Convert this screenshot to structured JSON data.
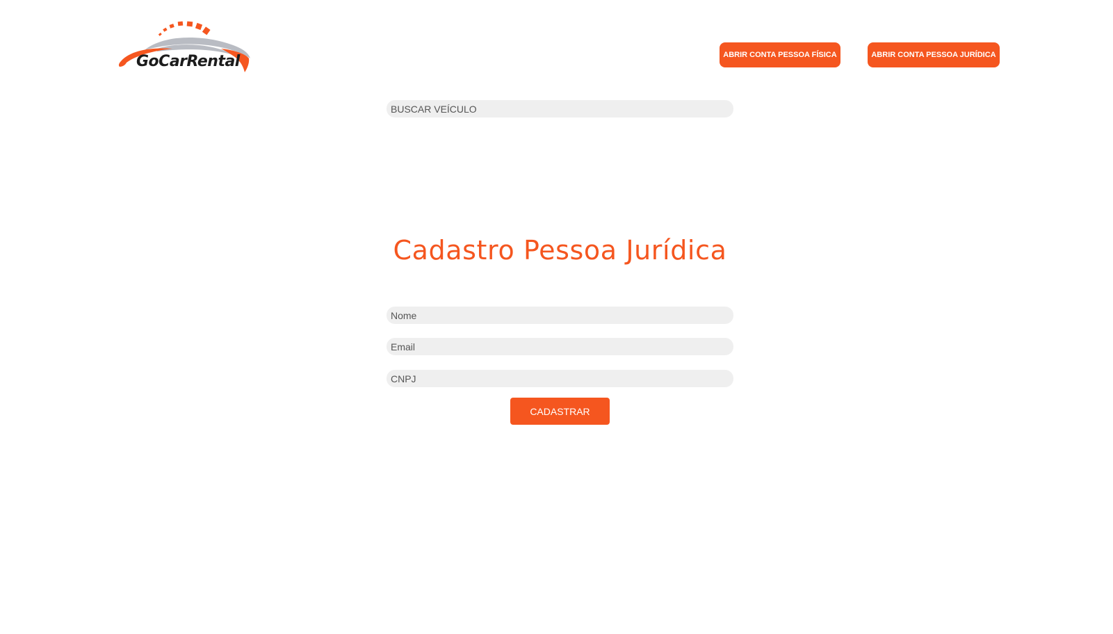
{
  "brand": {
    "logo_text": "GoCarRental",
    "accent_color": "#f5561f",
    "logo_gray": "#b9bcc3"
  },
  "header": {
    "pessoa_fisica_button": "ABRIR CONTA PESSOA FÍSICA",
    "pessoa_juridica_button": "ABRIR CONTA PESSOA JURÍDICA"
  },
  "search": {
    "placeholder": "BUSCAR VEÍCULO"
  },
  "form": {
    "title": "Cadastro Pessoa Jurídica",
    "nome_placeholder": "Nome",
    "email_placeholder": "Email",
    "cnpj_placeholder": "CNPJ",
    "submit_label": "CADASTRAR",
    "field_background": "#efefef"
  }
}
